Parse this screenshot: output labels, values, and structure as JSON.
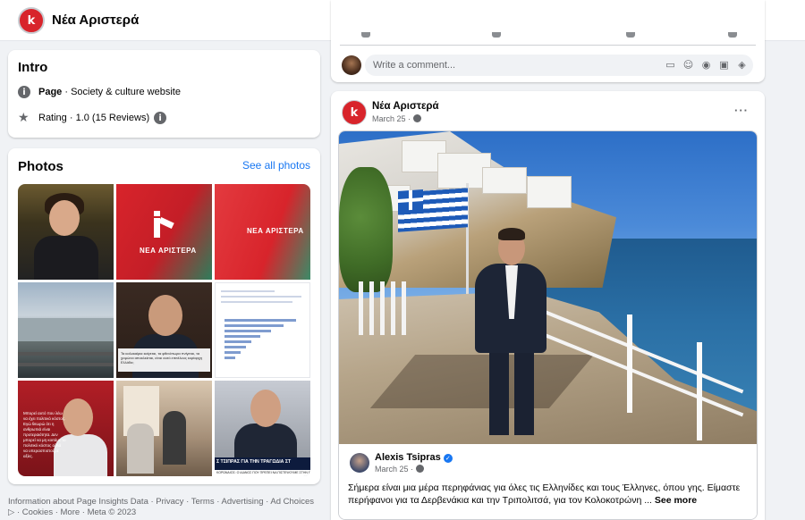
{
  "header": {
    "page_name": "Νέα Αριστερά",
    "more_label": "···",
    "logo_letter": "k"
  },
  "intro": {
    "title": "Intro",
    "page_label": "Page",
    "page_category": " · Society & culture website",
    "rating_text": "Rating · 1.0 (15 Reviews)",
    "rating_value": 1.0,
    "rating_count": 15,
    "info_icon": "i"
  },
  "photos": {
    "title": "Photos",
    "see_all": "See all photos",
    "tiles": [
      {
        "overlay": ""
      },
      {
        "overlay": "ΝΕΑ ΑΡΙΣΤΕΡΑ"
      },
      {
        "overlay": "ΝΕΑ ΑΡΙΣΤΕΡΑ"
      },
      {
        "overlay": ""
      },
      {
        "overlay": "Τα καλοκαίρια καίγεται, τα φθινόπωρα πνίγεται, τα χειμώνα αποκλείεται, είναι αυτό επιτέλους κυρίαρχη Ελλάδα;"
      },
      {
        "overlay": ""
      },
      {
        "overlay": "Μπορεί αυτό που λέω να έχει πολιτικό κόστος. Εγώ θεωρώ ότι η ανθρωπιά είναι προτεραιότητα. Δεν μπορεί να μη κοιτάμε το πολιτικό κόστος αλλά να υπερασπιστούμε αξίες."
      },
      {
        "overlay": ""
      },
      {
        "overlay": "Σ ΤΣΙΠΡΑΣ ΓΙΑ ΤΗΝ ΤΡΑΓΩΔΙΑ ΣΤ",
        "sub": "ΚΟΡΩΝΑΙΟΣ: Ο ΙΔΑΝΟΣ ΠΟΥ ΠΡΕΠΕΙ ΝΑ ΠΙΣΤΕΨΟΥΜΕ ΣΤΗΝ ΕΛΛΗΝΙΚΗ ΠΟΛ."
      }
    ]
  },
  "footer": {
    "links": "Information about Page Insights Data · Privacy · Terms · Advertising · Ad Choices ▷ · Cookies · More · Meta © 2023"
  },
  "comment": {
    "placeholder": "Write a comment...",
    "icons": [
      "sticker-icon",
      "emoji-icon",
      "camera-icon",
      "gif-icon",
      "sticker-face-icon"
    ]
  },
  "post": {
    "author": "Νέα Αριστερά",
    "date": "March 25 ·",
    "more_label": "···",
    "shared": {
      "author": "Alexis Tsipras",
      "date": "March 25 ·",
      "text": "Σήμερα είναι μια μέρα περηφάνιας για όλες τις Ελληνίδες και τους Έλληνες, όπου γης. Είμαστε περήφανοι για τα Δερβενάκια και την Τριπολιτσά, για τον Κολοκοτρώνη ...",
      "see_more": "See more",
      "verified_mark": "✓"
    }
  },
  "colors": {
    "brand_red": "#d8242b",
    "link_blue": "#1877f2",
    "background": "#f0f2f5"
  }
}
